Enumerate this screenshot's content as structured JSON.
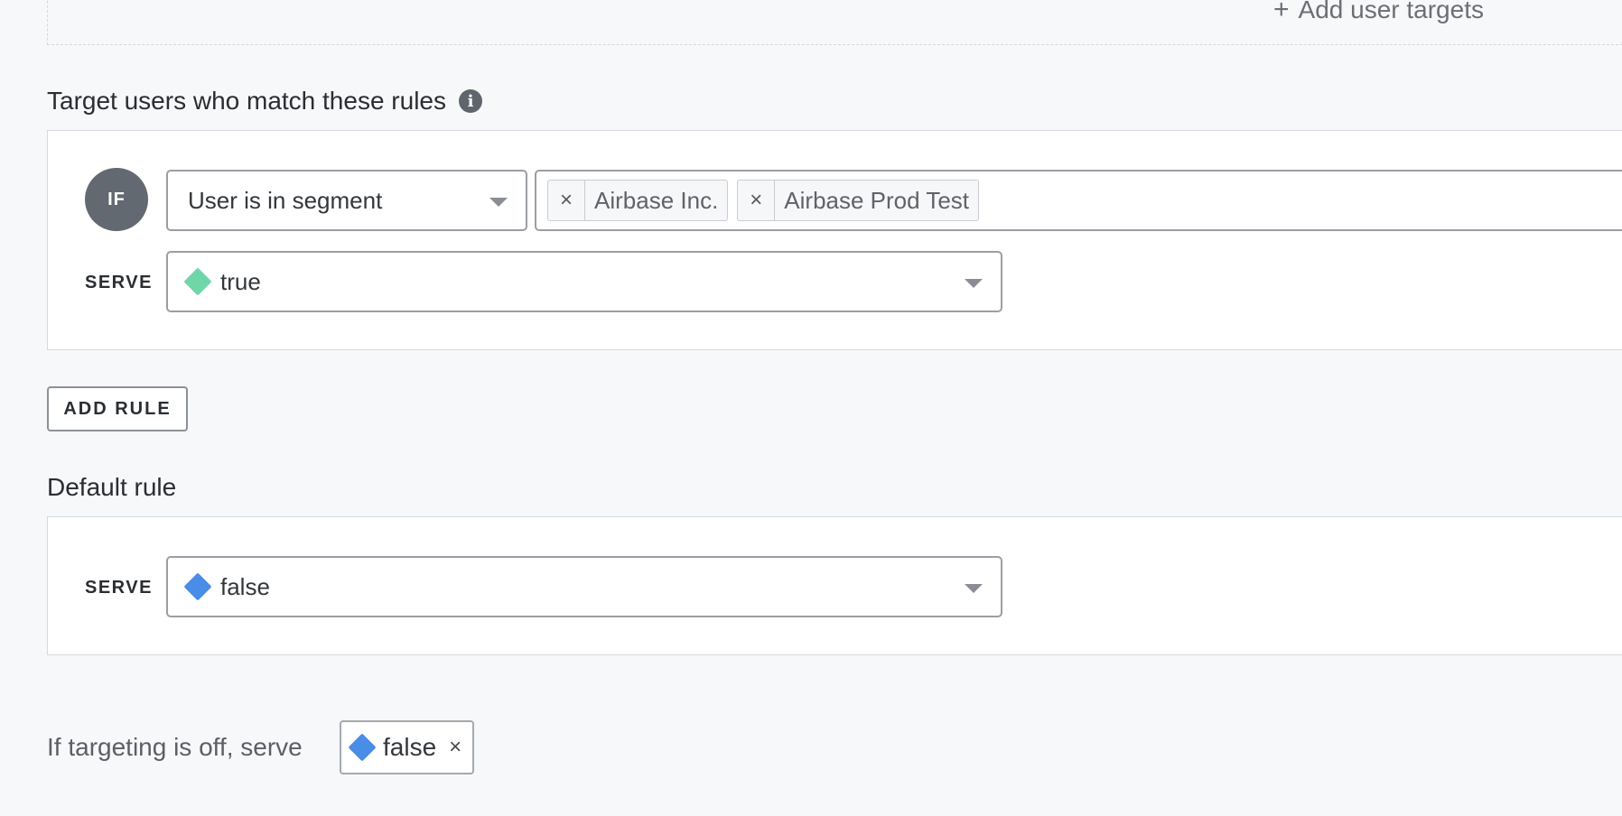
{
  "top": {
    "add_user_targets_label": "Add user targets",
    "plus_glyph": "+"
  },
  "rules_section": {
    "title": "Target users who match these rules",
    "info_icon_glyph": "i",
    "rule": {
      "if_label": "IF",
      "clause_operator": "User is in segment",
      "segments": [
        {
          "remove_glyph": "×",
          "label": "Airbase Inc."
        },
        {
          "remove_glyph": "×",
          "label": "Airbase Prod Test"
        }
      ],
      "serve_label": "SERVE",
      "serve_value": "true",
      "serve_color": "#6fd6a8"
    },
    "add_rule_label": "ADD RULE"
  },
  "default_section": {
    "title": "Default rule",
    "serve_label": "SERVE",
    "serve_value": "false",
    "serve_color": "#4a8de6"
  },
  "off_section": {
    "text": "If targeting is off, serve",
    "value": "false",
    "value_color": "#4a8de6",
    "remove_glyph": "×"
  }
}
